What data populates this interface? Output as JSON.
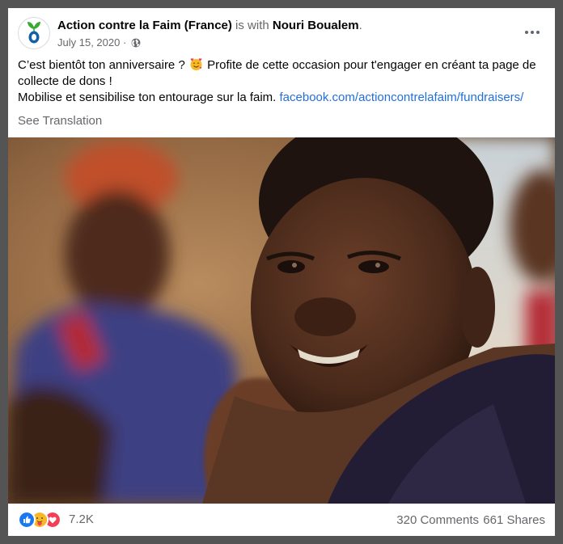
{
  "post": {
    "author": "Action contre la Faim (France)",
    "with_text": "is with",
    "tagged_user": "Nouri Boualem",
    "period": ".",
    "date": "July 15, 2020",
    "date_separator": "·",
    "audience_icon": "globe-icon",
    "more_icon": "more-icon",
    "line1_a": "C’est bientôt ton anniversaire ?",
    "line1_emoji": "smiling-face-with-hearts",
    "line1_b": "Profite de cette occasion pour t'engager en créant ta page de collecte de dons !",
    "line2_text": "Mobilise et sensibilise ton entourage sur la faim.",
    "link_text": "facebook.com/actioncontrelafaim/fundraisers/",
    "see_translation": "See Translation"
  },
  "reactions": {
    "icons": [
      "like-icon",
      "care-icon",
      "love-icon"
    ],
    "count": "7.2K"
  },
  "stats": {
    "comments": "320 Comments",
    "shares": "661 Shares"
  },
  "colors": {
    "link": "#216fdb",
    "muted": "#65676b",
    "like": "#1877f2",
    "love": "#f33e58",
    "care": "#f7b928",
    "logo_green": "#3aaa35",
    "logo_blue": "#1261a8"
  }
}
